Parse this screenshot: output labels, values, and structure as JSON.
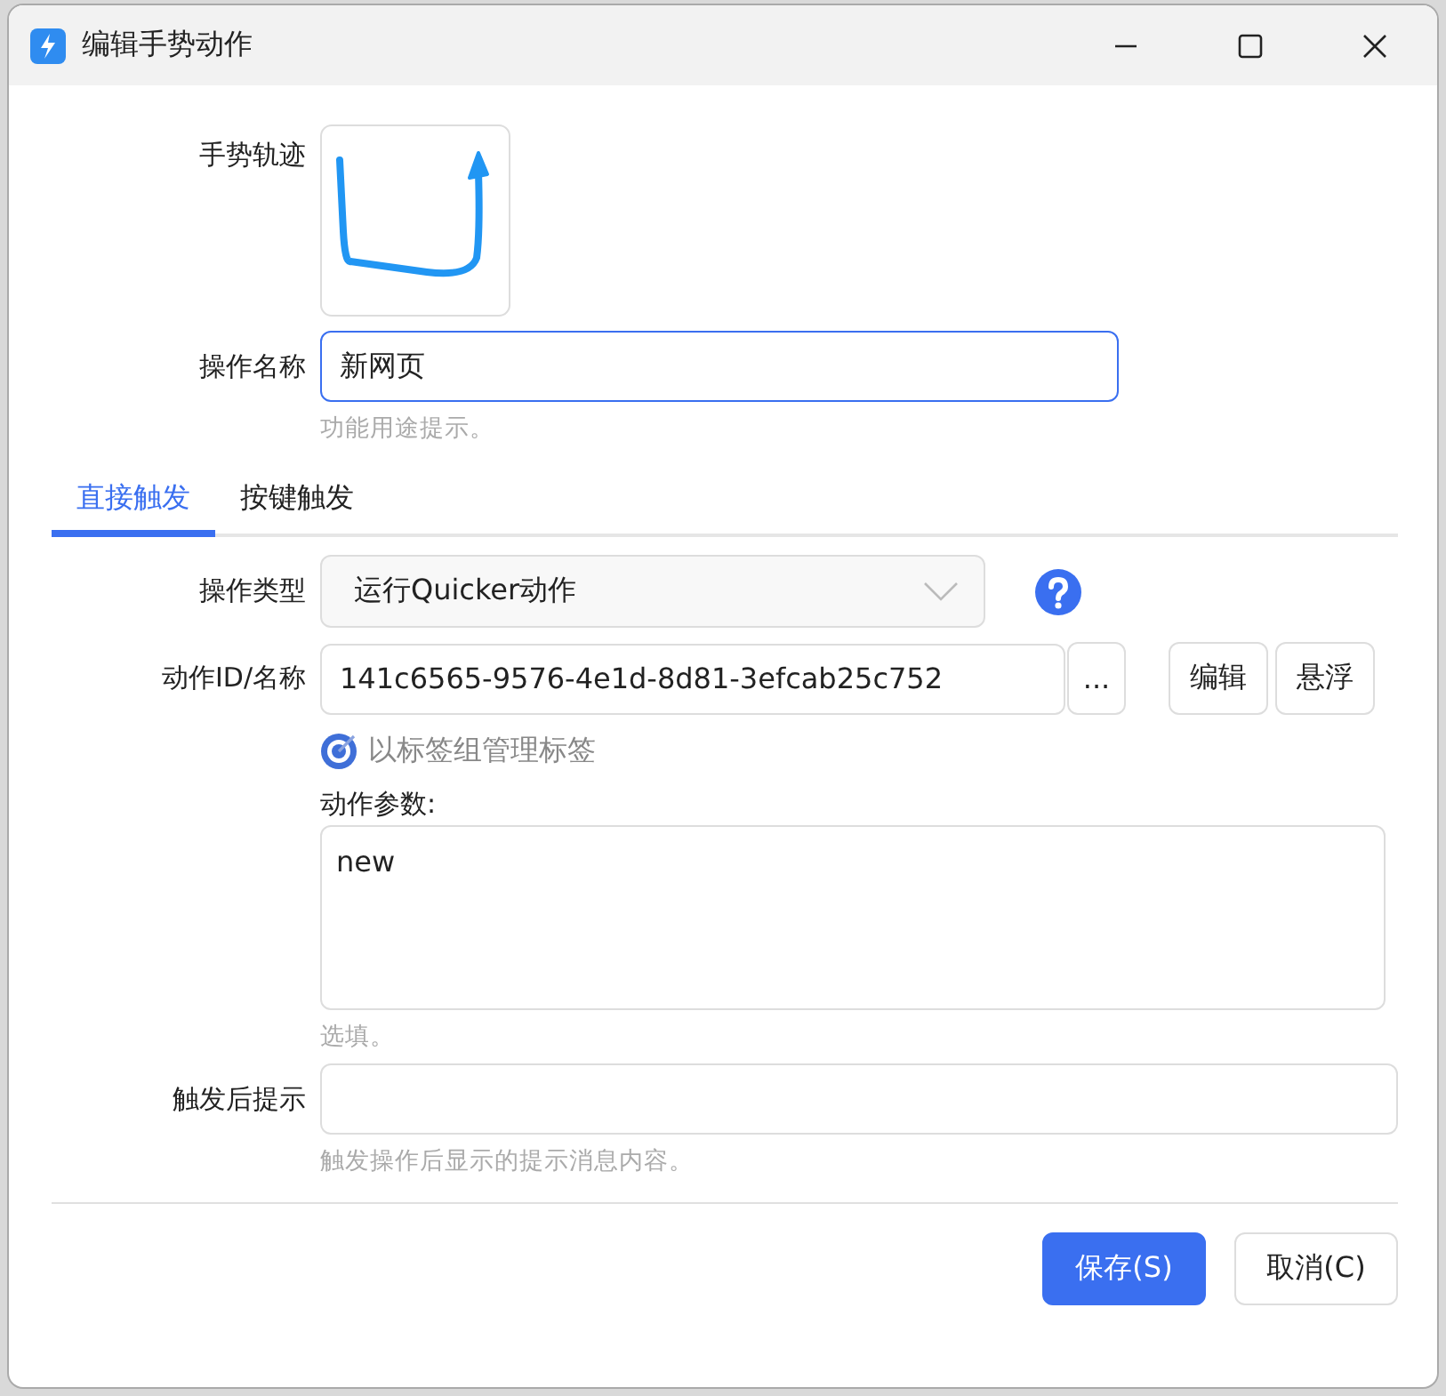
{
  "window": {
    "title": "编辑手势动作"
  },
  "gesture": {
    "label": "手势轨迹"
  },
  "name_field": {
    "label": "操作名称",
    "value": "新网页",
    "hint": "功能用途提示。",
    "focused": true
  },
  "tabs": [
    {
      "label": "直接触发",
      "selected": true
    },
    {
      "label": "按键触发",
      "selected": false
    }
  ],
  "action_type": {
    "label": "操作类型",
    "value": "运行Quicker动作"
  },
  "action_id": {
    "label": "动作ID/名称",
    "value": "141c6565-9576-4e1d-8d81-3efcab25c752",
    "browse_button": "...",
    "buttons": [
      "编辑",
      "悬浮"
    ]
  },
  "tag_link": "以标签组管理标签",
  "params": {
    "label": "动作参数:",
    "value": "new",
    "hint": "选填。"
  },
  "after_hint": {
    "label": "触发后提示",
    "hint": "触发操作后显示的提示消息内容。"
  },
  "buttons": [
    {
      "label": "保存(S)",
      "kind": "primary"
    },
    {
      "label": "取消(C)",
      "kind": "secondary"
    }
  ]
}
